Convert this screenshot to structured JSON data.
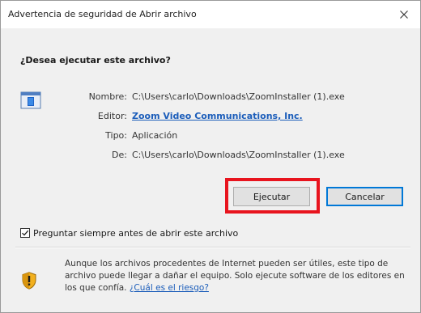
{
  "window": {
    "title": "Advertencia de seguridad de Abrir archivo",
    "close_icon": "close-icon"
  },
  "question": "¿Desea ejecutar este archivo?",
  "file_icon": "application-window-icon",
  "details": {
    "name_label": "Nombre:",
    "name_value": "C:\\Users\\carlo\\Downloads\\ZoomInstaller (1).exe",
    "publisher_label": "Editor:",
    "publisher_value": "Zoom Video Communications, Inc.",
    "type_label": "Tipo:",
    "type_value": "Aplicación",
    "from_label": "De:",
    "from_value": "C:\\Users\\carlo\\Downloads\\ZoomInstaller (1).exe"
  },
  "buttons": {
    "run_label": "Ejecutar",
    "cancel_label": "Cancelar"
  },
  "highlight_color": "#e8141e",
  "checkbox": {
    "label": "Preguntar siempre antes de abrir este archivo",
    "checked": true
  },
  "warning": {
    "icon": "shield-warning-icon",
    "text": "Aunque los archivos procedentes de Internet pueden ser útiles, este tipo de archivo puede llegar a dañar el equipo. Solo ejecute software de los editores en los que confía.",
    "link": "¿Cuál es el riesgo?"
  }
}
